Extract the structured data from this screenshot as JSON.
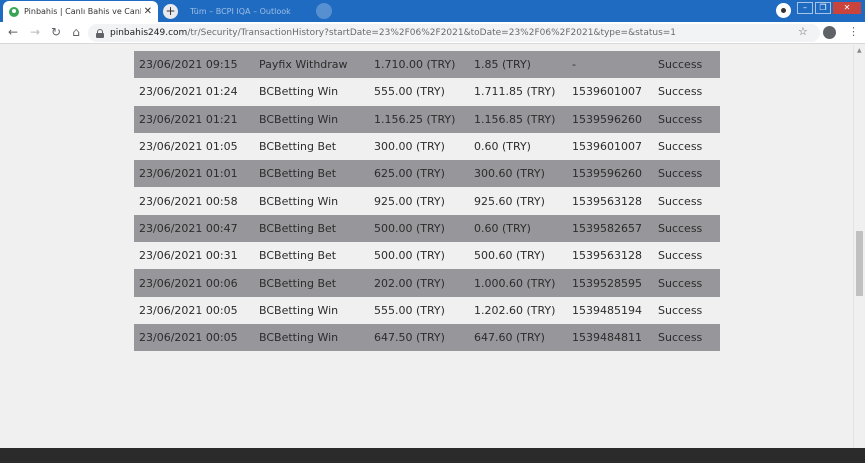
{
  "browser": {
    "active_tab_title": "Pinbahis | Canlı Bahis ve Canlı Ca",
    "inactive_tab_title": "Tüm – BCPI IQA – Outlook",
    "url_host": "pinbahis249.com",
    "url_path": "/tr/Security/TransactionHistory?startDate=23%2F06%2F2021&toDate=23%2F06%2F2021&type=&status=1"
  },
  "transactions": [
    {
      "date": "23/06/2021 09:15",
      "type": "Payfix Withdraw",
      "amount": "1.710.00 (TRY)",
      "balance": "1.85 (TRY)",
      "reference": "-",
      "status": "Success"
    },
    {
      "date": "23/06/2021 01:24",
      "type": "BCBetting Win",
      "amount": "555.00 (TRY)",
      "balance": "1.711.85 (TRY)",
      "reference": "1539601007",
      "status": "Success"
    },
    {
      "date": "23/06/2021 01:21",
      "type": "BCBetting Win",
      "amount": "1.156.25 (TRY)",
      "balance": "1.156.85 (TRY)",
      "reference": "1539596260",
      "status": "Success"
    },
    {
      "date": "23/06/2021 01:05",
      "type": "BCBetting Bet",
      "amount": "300.00 (TRY)",
      "balance": "0.60 (TRY)",
      "reference": "1539601007",
      "status": "Success"
    },
    {
      "date": "23/06/2021 01:01",
      "type": "BCBetting Bet",
      "amount": "625.00 (TRY)",
      "balance": "300.60 (TRY)",
      "reference": "1539596260",
      "status": "Success"
    },
    {
      "date": "23/06/2021 00:58",
      "type": "BCBetting Win",
      "amount": "925.00 (TRY)",
      "balance": "925.60 (TRY)",
      "reference": "1539563128",
      "status": "Success"
    },
    {
      "date": "23/06/2021 00:47",
      "type": "BCBetting Bet",
      "amount": "500.00 (TRY)",
      "balance": "0.60 (TRY)",
      "reference": "1539582657",
      "status": "Success"
    },
    {
      "date": "23/06/2021 00:31",
      "type": "BCBetting Bet",
      "amount": "500.00 (TRY)",
      "balance": "500.60 (TRY)",
      "reference": "1539563128",
      "status": "Success"
    },
    {
      "date": "23/06/2021 00:06",
      "type": "BCBetting Bet",
      "amount": "202.00 (TRY)",
      "balance": "1.000.60 (TRY)",
      "reference": "1539528595",
      "status": "Success"
    },
    {
      "date": "23/06/2021 00:05",
      "type": "BCBetting Win",
      "amount": "555.00 (TRY)",
      "balance": "1.202.60 (TRY)",
      "reference": "1539485194",
      "status": "Success"
    },
    {
      "date": "23/06/2021 00:05",
      "type": "BCBetting Win",
      "amount": "647.50 (TRY)",
      "balance": "647.60 (TRY)",
      "reference": "1539484811",
      "status": "Success"
    }
  ]
}
